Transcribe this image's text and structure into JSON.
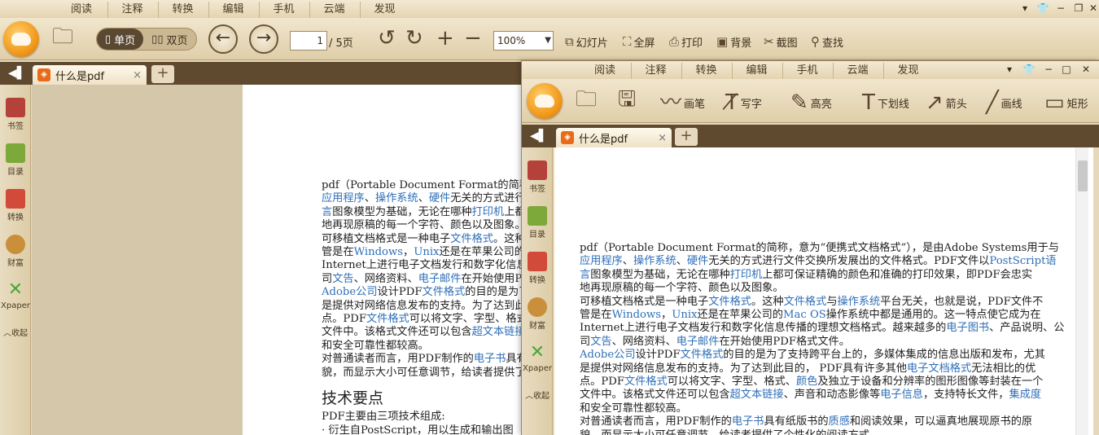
{
  "window1": {
    "menu": [
      "阅读",
      "注释",
      "转换",
      "编辑",
      "手机",
      "云端",
      "发现"
    ],
    "toolbar": {
      "open_label": "",
      "single_page": "单页",
      "double_page": "双页",
      "page_current": "1",
      "page_total": "/ 5页",
      "zoom": "100%",
      "slideshow": "幻灯片",
      "fullscreen": "全屏",
      "print": "打印",
      "background": "背景",
      "screenshot": "截图",
      "find": "查找"
    },
    "tab": {
      "title": "什么是pdf",
      "close": "×",
      "new": "+"
    },
    "sidebar": [
      {
        "label": "书签",
        "icon": "bookmark-icon",
        "color": "#b5423a"
      },
      {
        "label": "目录",
        "icon": "toc-icon",
        "color": "#7da83a"
      },
      {
        "label": "转换",
        "icon": "convert-icon",
        "color": "#d24a3a"
      },
      {
        "label": "财富",
        "icon": "money-bag-icon",
        "color": "#c98f3a"
      },
      {
        "label": "Xpaper",
        "icon": "xpaper-icon",
        "color": "#4aa83a"
      },
      {
        "label": "收起",
        "icon": "collapse-icon",
        "color": "#6b5538"
      }
    ]
  },
  "window2": {
    "menu": [
      "阅读",
      "注释",
      "转换",
      "编辑",
      "手机",
      "云端",
      "发现"
    ],
    "toolbar": {
      "pen": "画笔",
      "write": "写字",
      "highlight": "高亮",
      "underline": "下划线",
      "arrow": "箭头",
      "line": "画线",
      "rect": "矩形"
    },
    "tab": {
      "title": "什么是pdf",
      "close": "×",
      "new": "+"
    },
    "sidebar": [
      {
        "label": "书签",
        "icon": "bookmark-icon",
        "color": "#b5423a"
      },
      {
        "label": "目录",
        "icon": "toc-icon",
        "color": "#7da83a"
      },
      {
        "label": "转换",
        "icon": "convert-icon",
        "color": "#d24a3a"
      },
      {
        "label": "财富",
        "icon": "money-bag-icon",
        "color": "#c98f3a"
      },
      {
        "label": "Xpaper",
        "icon": "xpaper-icon",
        "color": "#4aa83a"
      },
      {
        "label": "收起",
        "icon": "collapse-icon",
        "color": "#6b5538"
      }
    ]
  },
  "document_left": {
    "heading": "技术要点",
    "after_heading": [
      "PDF主要由三项技术组成:",
      "· 衍生自PostScript，用以生成和输出图"
    ]
  },
  "document": {
    "paragraphs": [
      [
        [
          [
            "pdf（Portable Document Format的简称，意为“便携式文档格式”），是由Adobe Systems用于与",
            0
          ]
        ],
        [
          [
            "应用程序",
            1
          ],
          [
            "、",
            0
          ],
          [
            "操作系统",
            1
          ],
          [
            "、",
            0
          ],
          [
            "硬件",
            1
          ],
          [
            "无关的方式进行文件交换所发展出的文件格式。PDF文件以",
            0
          ],
          [
            "PostScript语",
            1
          ]
        ],
        [
          [
            "言",
            1
          ],
          [
            "图象模型为基础，无论在哪种",
            0
          ],
          [
            "打印机",
            1
          ],
          [
            "上都可保证精确的颜色和准确的打印效果，即PDF会忠实",
            0
          ]
        ],
        [
          [
            "地再现原稿的每一个字符、颜色以及图象。",
            0
          ]
        ]
      ],
      [
        [
          [
            "可移植文档格式是一种电子",
            0
          ],
          [
            "文件格式",
            1
          ],
          [
            "。这种",
            0
          ],
          [
            "文件格式",
            1
          ],
          [
            "与",
            0
          ],
          [
            "操作系统",
            1
          ],
          [
            "平台无关，也就是说，PDF文件不",
            0
          ]
        ],
        [
          [
            "管是在",
            0
          ],
          [
            "Windows",
            1
          ],
          [
            "，",
            0
          ],
          [
            "Unix",
            1
          ],
          [
            "还是在苹果公司的",
            0
          ],
          [
            "Mac OS",
            1
          ],
          [
            "操作系统中都是通用的。这一特点使它成为在",
            0
          ]
        ],
        [
          [
            "Internet上进行电子文档发行和数字化信息传播的理想文档格式。越来越多的",
            0
          ],
          [
            "电子图书",
            1
          ],
          [
            "、产品说明、公",
            0
          ]
        ],
        [
          [
            "司",
            0
          ],
          [
            "文告",
            1
          ],
          [
            "、网络资料、",
            0
          ],
          [
            "电子邮件",
            1
          ],
          [
            "在开始使用PDF格式文件。",
            0
          ]
        ]
      ],
      [
        [
          [
            "Adobe公司",
            1
          ],
          [
            "设计PDF",
            0
          ],
          [
            "文件格式",
            1
          ],
          [
            "的目的是为了支持跨平台上的，多媒体集成的信息出版和发布，尤其",
            0
          ]
        ],
        [
          [
            "是提供对网络信息发布的支持。为了达到此目的， PDF具有许多其他",
            0
          ],
          [
            "电子文档格式",
            1
          ],
          [
            "无法相比的优",
            0
          ]
        ],
        [
          [
            "点。PDF",
            0
          ],
          [
            "文件格式",
            1
          ],
          [
            "可以将文字、字型、格式、",
            0
          ],
          [
            "颜色",
            1
          ],
          [
            "及独立于设备和分辨率的图形图像等封装在一个",
            0
          ]
        ],
        [
          [
            "文件中。该格式文件还可以包含",
            0
          ],
          [
            "超文本链接",
            1
          ],
          [
            "、声音和动态影像等",
            0
          ],
          [
            "电子信息",
            1
          ],
          [
            "，支持特长文件，",
            0
          ],
          [
            "集成度",
            1
          ]
        ],
        [
          [
            "和安全可靠性都较高。",
            0
          ]
        ]
      ],
      [
        [
          [
            "对普通读者而言，用PDF制作的",
            0
          ],
          [
            "电子书",
            1
          ],
          [
            "具有纸版书的",
            0
          ],
          [
            "质感",
            1
          ],
          [
            "和阅读效果，可以逼真地展现原书的原",
            0
          ]
        ],
        [
          [
            "貌，而显示大小可任意调节，给读者提供了个性化的阅读方式。",
            0
          ]
        ]
      ]
    ]
  }
}
